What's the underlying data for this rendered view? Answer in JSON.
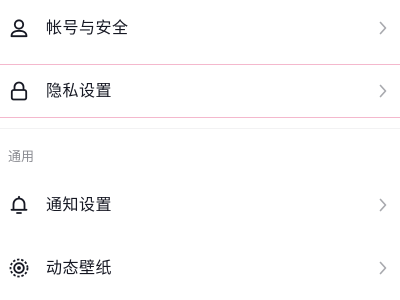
{
  "settings": {
    "items": [
      {
        "label": "帐号与安全",
        "icon": "person-icon"
      },
      {
        "label": "隐私设置",
        "icon": "lock-icon"
      }
    ],
    "general_section": {
      "title": "通用",
      "items": [
        {
          "label": "通知设置",
          "icon": "bell-icon"
        },
        {
          "label": "动态壁纸",
          "icon": "live-wallpaper-icon"
        }
      ]
    }
  },
  "colors": {
    "text": "#161823",
    "secondary_text": "#8a8b91",
    "chevron": "#a8a9ae",
    "highlight_border": "#f4b8cd"
  }
}
